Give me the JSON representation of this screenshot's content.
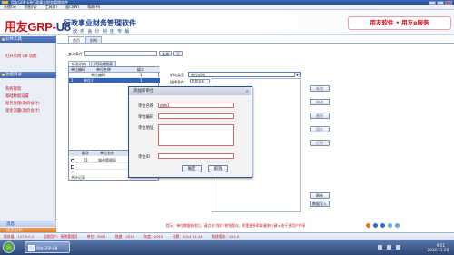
{
  "window": {
    "title": "用友GRP-U8行政事业财务管理软件"
  },
  "menubar": [
    "系统(S)",
    "视图(V)",
    "工具(T)",
    "窗口(W)",
    "帮助(H)"
  ],
  "banner": {
    "logo_text": "用友GRP-",
    "logo_grp": "U8",
    "product_title": "行政事业财务管理软件",
    "product_subtitle": "政 府 会 计 制 度 专 版",
    "slogan": "用友软件 • 用友e服务"
  },
  "left_panel": {
    "section1_title": "公共工具",
    "section1_items": [
      "打开常用 U8 功能"
    ],
    "section2_title": "功能目录",
    "section2_items": [
      "系统管理",
      "基础数据设置",
      "账务处理(政府会计)",
      "现金流量(政府会计)"
    ],
    "bottom_items": [
      "消息",
      "报表分析"
    ]
  },
  "main": {
    "tabs": [
      "首页",
      "机构"
    ],
    "query_label": "查询条件",
    "query_button": "查询",
    "next_button": "下",
    "list_tabs": [
      "标准机构",
      "代码对照表"
    ],
    "left_table": {
      "headers": [
        "单位编码",
        "单位名称",
        "级次"
      ],
      "rows": [
        {
          "code": "",
          "name": "单位编码",
          "level": "1"
        },
        {
          "code": "1",
          "name": "单位1",
          "level": "1"
        }
      ]
    },
    "bottom_table": {
      "headers": [
        "",
        "级次",
        "单位名称"
      ],
      "rows": [
        {
          "level": "01",
          "name": "城市管理局",
          "selected": true
        },
        {
          "level": "",
          "name": "",
          "selected": false
        }
      ],
      "footer": "共计记录"
    },
    "right_panel": {
      "type_label": "机构类型",
      "type_value": "单位机构",
      "filter_label": "选择条件",
      "filter_value": "机构名称",
      "side_buttons": [
        "新增",
        "修改",
        "删除",
        "保存",
        "打印"
      ],
      "bottom_buttons": [
        "刷新",
        "数据导入"
      ]
    }
  },
  "dialog": {
    "title": "添加新单位",
    "fields": [
      {
        "label": "单位名称",
        "value": "机构1"
      },
      {
        "label": "单位编码",
        "value": ""
      },
      {
        "label": "单位地址",
        "value": ""
      },
      {
        "label": "单位ID",
        "value": ""
      }
    ],
    "ok_button": "确定",
    "cancel_button": "取消",
    "close_icon": "close-icon"
  },
  "tip": "提示：单位数据修改后，请点击“保存”按钮保存，如需更多帮助请按F1键 ▸ 由于多用户共享",
  "statusbar": {
    "items": [
      "服务器：127.0.0.1",
      "当前用户：系统管理员",
      "单位：0001",
      "账套：2019",
      "年度：2019",
      "日期：2014-11-28",
      "系统版本：V11.0"
    ]
  },
  "taskbar": {
    "app_item": "用友GRP-U8",
    "clock_time": "9:51",
    "clock_date": "2014-11-28"
  },
  "colors": {
    "brand_red": "#c4161c",
    "brand_blue": "#1b3d8f",
    "selection": "#3163b7",
    "orange": "#d96a17"
  }
}
